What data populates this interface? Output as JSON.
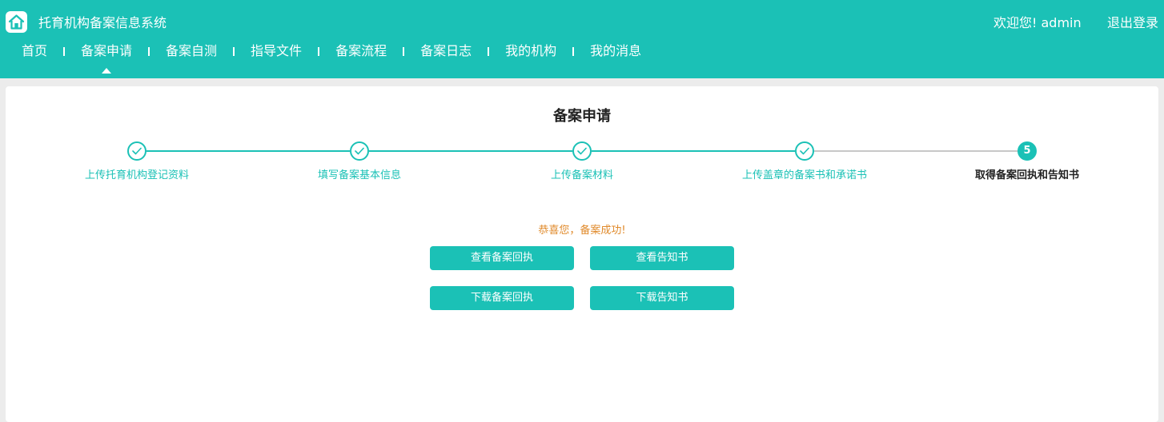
{
  "header": {
    "app_title": "托育机构备案信息系统",
    "welcome": "欢迎您!  admin",
    "logout": "退出登录",
    "logo_icon": "home-icon",
    "bg_color": "#1bc1b6"
  },
  "nav": {
    "items": [
      {
        "label": "首页"
      },
      {
        "label": "备案申请",
        "active": true
      },
      {
        "label": "备案自测"
      },
      {
        "label": "指导文件"
      },
      {
        "label": "备案流程"
      },
      {
        "label": "备案日志"
      },
      {
        "label": "我的机构"
      },
      {
        "label": "我的消息"
      }
    ]
  },
  "main": {
    "title": "备案申请",
    "steps": [
      {
        "label": "上传托育机构登记资料",
        "status": "done"
      },
      {
        "label": "填写备案基本信息",
        "status": "done"
      },
      {
        "label": "上传备案材料",
        "status": "done"
      },
      {
        "label": "上传盖章的备案书和承诺书",
        "status": "done"
      },
      {
        "label": "取得备案回执和告知书",
        "number": "5",
        "status": "active"
      }
    ],
    "success_message": "恭喜您，备案成功!",
    "buttons": {
      "view_receipt": "查看备案回执",
      "view_notice": "查看告知书",
      "download_receipt": "下载备案回执",
      "download_notice": "下载告知书"
    }
  }
}
